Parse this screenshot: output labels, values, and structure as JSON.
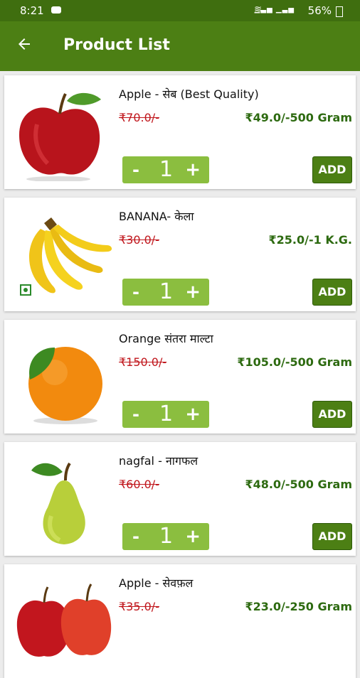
{
  "status": {
    "time": "8:21",
    "battery": "56%"
  },
  "appbar": {
    "title": "Product List"
  },
  "products": [
    {
      "name": "Apple - सेब (Best Quality)",
      "mrp": "₹70.0/-",
      "price": "₹49.0/-500 Gram",
      "qty": "1",
      "add": "ADD",
      "icon": "apple-icon"
    },
    {
      "name": "BANANA- केला",
      "mrp": "₹30.0/-",
      "price": "₹25.0/-1 K.G.",
      "qty": "1",
      "add": "ADD",
      "icon": "banana-icon"
    },
    {
      "name": "Orange संतरा माल्टा",
      "mrp": "₹150.0/-",
      "price": "₹105.0/-500 Gram",
      "qty": "1",
      "add": "ADD",
      "icon": "orange-icon"
    },
    {
      "name": "nagfal - नागफल",
      "mrp": "₹60.0/-",
      "price": "₹48.0/-500 Gram",
      "qty": "1",
      "add": "ADD",
      "icon": "pear-icon"
    },
    {
      "name": "Apple - सेवफ़ल",
      "mrp": "₹35.0/-",
      "price": "₹23.0/-250 Gram",
      "icon": "apples-icon"
    }
  ],
  "stepper": {
    "minus": "-",
    "plus": "+"
  },
  "colors": {
    "appbar": "#4c7f14",
    "status": "#3f6e0f",
    "price": "#2d6a10",
    "mrp": "#c0161c",
    "stepper": "#8bbe3f"
  }
}
